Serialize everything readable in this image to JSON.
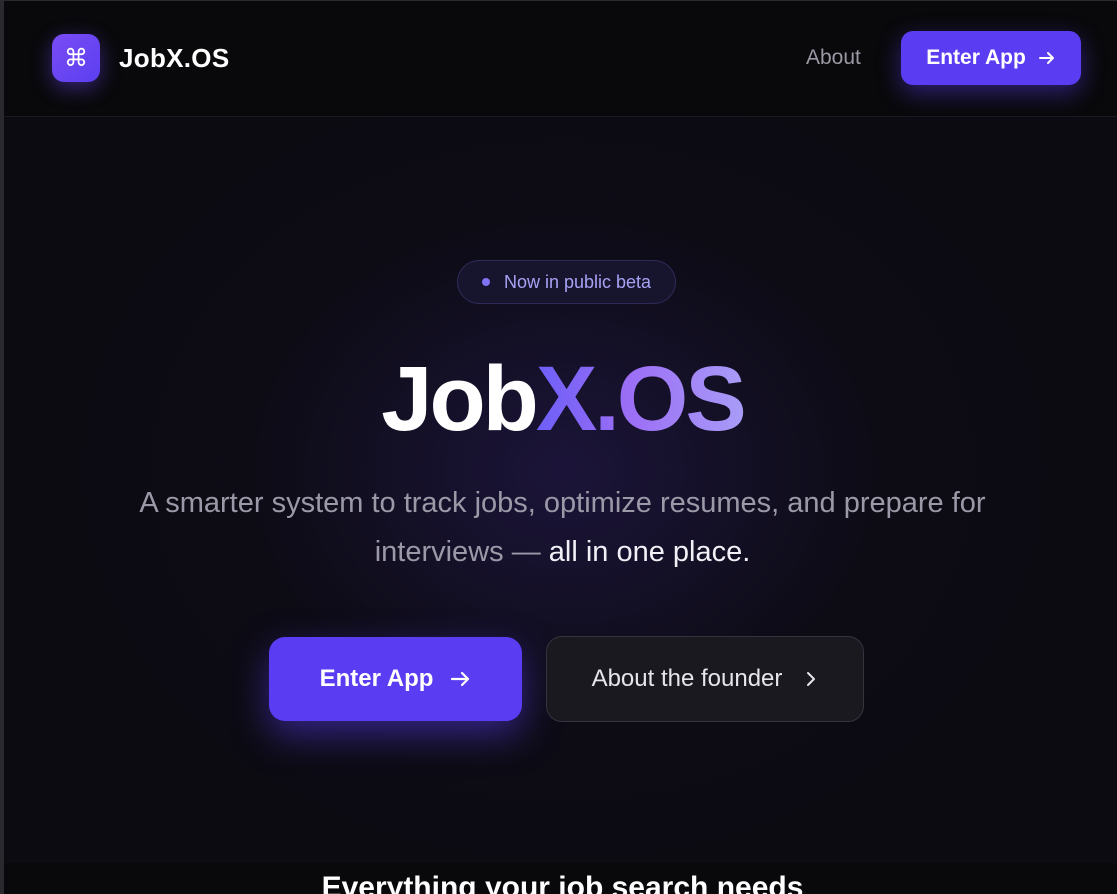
{
  "nav": {
    "logo_glyph": "⌘",
    "brand": "JobX.OS",
    "about_label": "About",
    "enter_label": "Enter App"
  },
  "hero": {
    "badge": "Now in public beta",
    "title_part1": "Job",
    "title_part2": "X.OS",
    "subtitle_main": "A smarter system to track jobs, optimize resumes, and prepare for interviews — ",
    "subtitle_highlight": "all in one place.",
    "primary_cta": "Enter App",
    "secondary_cta": "About the founder"
  },
  "features": {
    "heading": "Everything your job search needs"
  },
  "colors": {
    "accent": "#5a3cf2",
    "background": "#0c0b12",
    "badge_text": "#a8a2f5"
  },
  "icons": {
    "logo": "command-icon",
    "arrow": "arrow-right-icon",
    "chevron": "chevron-right-icon"
  }
}
